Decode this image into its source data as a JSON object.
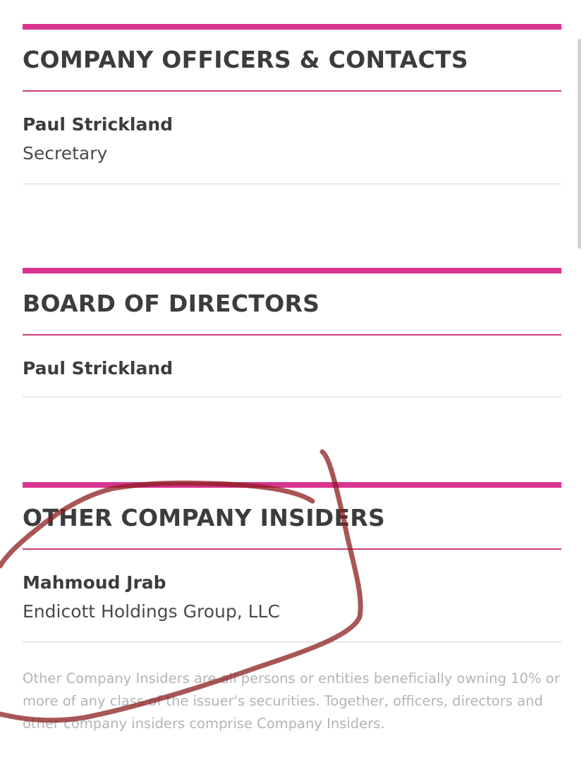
{
  "sections": [
    {
      "title": "COMPANY OFFICERS & CONTACTS",
      "people": [
        {
          "name": "Paul Strickland",
          "role": "Secretary"
        }
      ]
    },
    {
      "title": "BOARD OF DIRECTORS",
      "people": [
        {
          "name": "Paul Strickland"
        }
      ]
    },
    {
      "title": "OTHER COMPANY INSIDERS",
      "people": [
        {
          "name": "Mahmoud Jrab",
          "role": "Endicott Holdings Group, LLC"
        }
      ],
      "footnote": "Other Company Insiders are all persons or entities beneficially owning 10% or more of any class of the issuer's securities. Together, officers, directors and other company insiders comprise Company Insiders."
    }
  ],
  "colors": {
    "accent": "#d9348f",
    "title_rule": "#c9407f",
    "annotation_ink": "#8b1e1e"
  }
}
